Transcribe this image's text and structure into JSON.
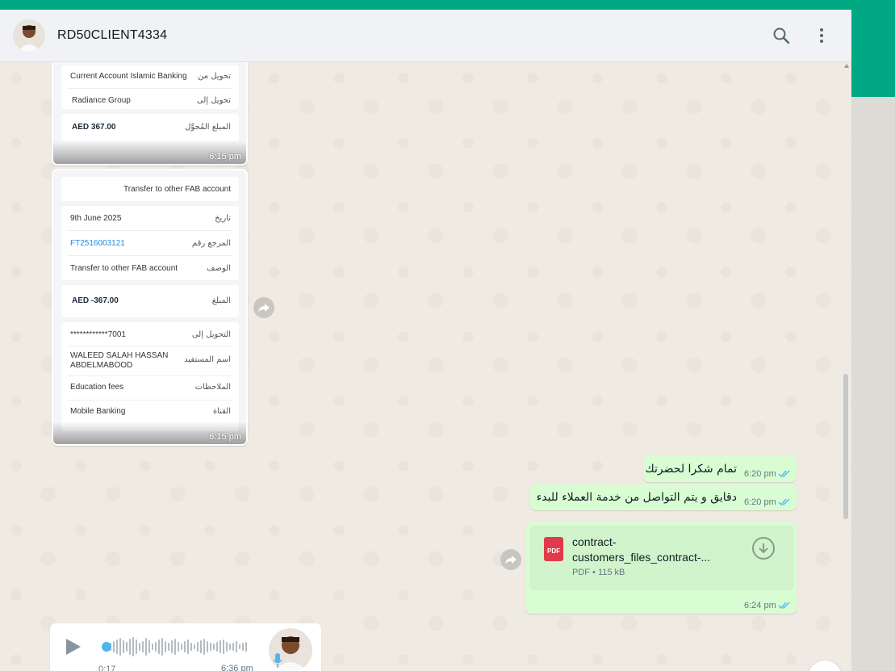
{
  "header": {
    "contact_name": "RD50CLIENT4334"
  },
  "icons": {
    "search": "search-icon",
    "menu": "kebab-menu-icon",
    "forward": "forward-icon",
    "download": "download-icon",
    "mic": "mic-icon",
    "play": "play-icon",
    "chevron": "chevron-down-icon",
    "ticks": "double-check-icon"
  },
  "colors": {
    "accent": "#00a884",
    "outgoing_bubble": "#d9fdd3",
    "read_ticks": "#53bdeb",
    "pdf_red": "#e03b4a"
  },
  "image1": {
    "rows": [
      {
        "label": "تحويل من",
        "value": "Current Account Islamic Banking"
      },
      {
        "label": "تحويل إلى",
        "value": "Radiance Group"
      },
      {
        "label": "المبلغ المُحوَّل",
        "value": "AED 367.00"
      }
    ],
    "time": "6:15 pm"
  },
  "image2": {
    "title": "Transfer to other FAB account",
    "rows": [
      {
        "label": "تاريخ",
        "value": "9th June 2025"
      },
      {
        "label": "المرجع رقم",
        "value": "FT2516003121"
      },
      {
        "label": "الوصف",
        "value": "Transfer to other FAB account"
      },
      {
        "label": "المبلغ",
        "value": "AED -367.00"
      },
      {
        "label": "التحويل إلى",
        "value": "************7001"
      },
      {
        "label": "اسم المستفيد",
        "value": "WALEED SALAH HASSAN",
        "value2": "ABDELMABOOD"
      },
      {
        "label": "الملاحظات",
        "value": "Education fees"
      },
      {
        "label": "القناة",
        "value": "Mobile Banking"
      }
    ],
    "time": "6:15 pm"
  },
  "messages": [
    {
      "text": "تمام شكرا لحضرتك",
      "time": "6:20 pm"
    },
    {
      "text": "دقايق و يتم التواصل من خدمة العملاء للبدء",
      "time": "6:20 pm"
    }
  ],
  "file": {
    "icon_label": "PDF",
    "name_line1": "contract-",
    "name_line2": "customers_files_contract-...",
    "meta": "PDF • 115 kB",
    "time": "6:24 pm"
  },
  "voice": {
    "duration": "0:17",
    "time": "6:36 pm"
  }
}
